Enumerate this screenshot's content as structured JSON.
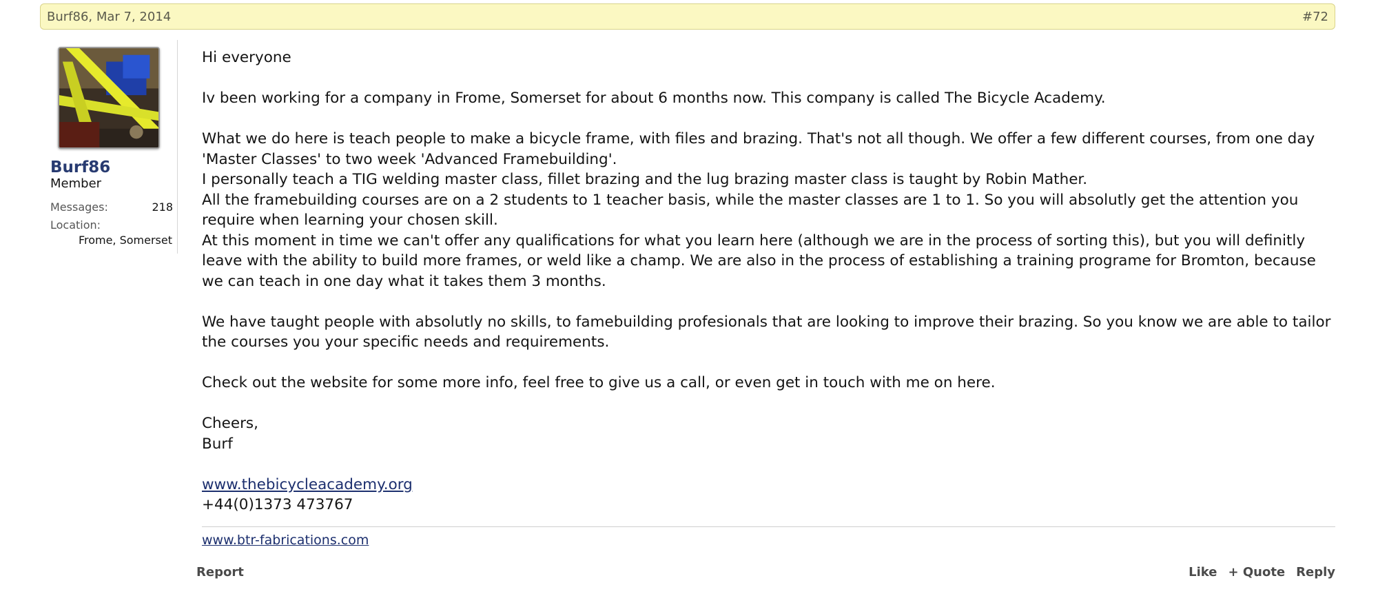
{
  "post": {
    "author_date": "Burf86, Mar 7, 2014",
    "number": "#72"
  },
  "user": {
    "name": "Burf86",
    "title": "Member",
    "messages_label": "Messages:",
    "messages_value": "218",
    "location_label": "Location:",
    "location_value": "Frome, Somerset"
  },
  "message": {
    "greeting": "Hi everyone",
    "para1": "Iv been working for a company in Frome, Somerset for about 6 months now. This company is called The Bicycle Academy.",
    "para2_line1": "What we do here is teach people to make a bicycle frame, with files and brazing. That's not all though. We offer a few different courses, from one day 'Master Classes' to two week 'Advanced Framebuilding'.",
    "para2_line2": "I personally teach a TIG welding master class, fillet brazing and the lug brazing master class is taught by Robin Mather.",
    "para2_line3": "All the framebuilding courses are on a 2 students to 1 teacher basis, while the master classes are 1 to 1. So you will absolutly get the attention you require when learning your chosen skill.",
    "para2_line4": "At this moment in time we can't offer any qualifications for what you learn here (although we are in the process of sorting this), but you will definitly leave with the ability to build more frames, or weld like a champ. We are also in the process of establishing a training programe for Bromton, because we can teach in one day what it takes them 3 months.",
    "para3": "We have taught people with absolutly no skills, to famebuilding profesionals that are looking to improve their brazing. So you know we are able to tailor the courses you your specific needs and requirements.",
    "para4": "Check out the website for some more info, feel free to give us a call, or even get in touch with me on here.",
    "signoff1": "Cheers,",
    "signoff2": "Burf",
    "website_link": "www.thebicycleacademy.org",
    "phone": "+44(0)1373 473767"
  },
  "signature": {
    "link": "www.btr-fabrications.com"
  },
  "controls": {
    "report": "Report",
    "like": "Like",
    "quote": "+ Quote",
    "reply": "Reply"
  }
}
